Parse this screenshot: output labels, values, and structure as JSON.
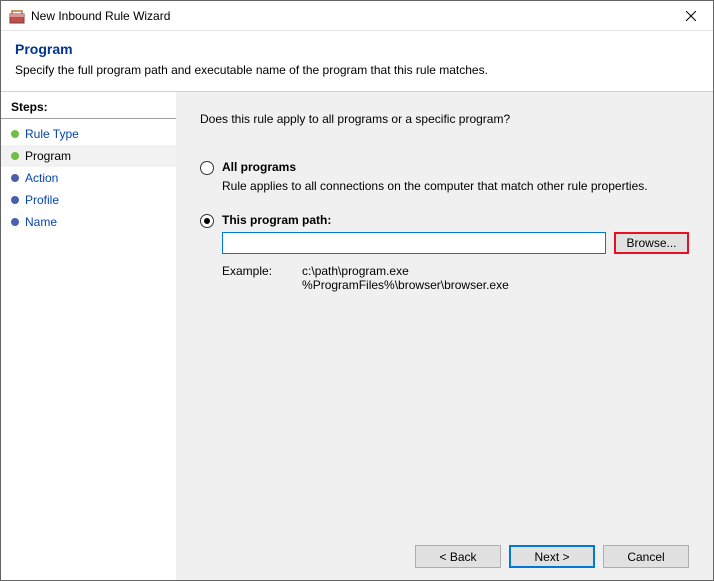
{
  "window": {
    "title": "New Inbound Rule Wizard"
  },
  "header": {
    "title": "Program",
    "subtitle": "Specify the full program path and executable name of the program that this rule matches."
  },
  "sidebar": {
    "title": "Steps:",
    "items": [
      {
        "label": "Rule Type",
        "state": "done"
      },
      {
        "label": "Program",
        "state": "current"
      },
      {
        "label": "Action",
        "state": "pending"
      },
      {
        "label": "Profile",
        "state": "pending"
      },
      {
        "label": "Name",
        "state": "pending"
      }
    ]
  },
  "content": {
    "question": "Does this rule apply to all programs or a specific program?",
    "options": {
      "all": {
        "label": "All programs",
        "desc": "Rule applies to all connections on the computer that match other rule properties."
      },
      "path": {
        "label": "This program path:",
        "value": "",
        "browse": "Browse...",
        "example_label": "Example:",
        "example_paths": "c:\\path\\program.exe\n%ProgramFiles%\\browser\\browser.exe"
      }
    }
  },
  "footer": {
    "back": "< Back",
    "next": "Next >",
    "cancel": "Cancel"
  }
}
